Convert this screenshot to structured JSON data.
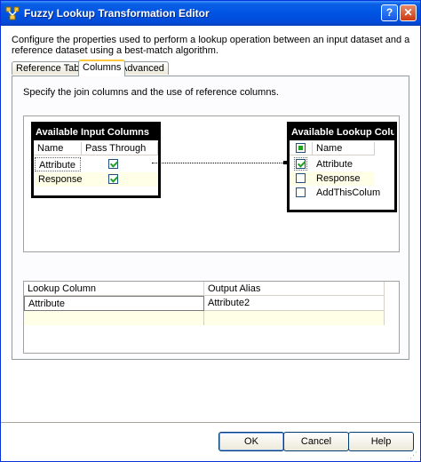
{
  "window": {
    "title": "Fuzzy Lookup Transformation Editor",
    "help_glyph": "?",
    "close_glyph": "✕"
  },
  "description": "Configure the properties used to perform a lookup operation between an input dataset and a reference dataset using a best-match algorithm.",
  "tabs": [
    {
      "label": "Reference Table",
      "active": false
    },
    {
      "label": "Columns",
      "active": true
    },
    {
      "label": "Advanced",
      "active": false
    }
  ],
  "instructions": "Specify the join columns and the use of reference columns.",
  "input_box": {
    "title": "Available Input Columns",
    "headers": {
      "name": "Name",
      "pass": "Pass Through"
    },
    "rows": [
      {
        "name": "Attribute",
        "pass_through": true
      },
      {
        "name": "Response",
        "pass_through": true
      }
    ]
  },
  "lookup_box": {
    "title": "Available Lookup Colu",
    "header_name": "Name",
    "rows": [
      {
        "name": "Attribute",
        "checked": true
      },
      {
        "name": "Response",
        "checked": false
      },
      {
        "name": "AddThisColum",
        "checked": false
      }
    ]
  },
  "grid": {
    "headers": {
      "lookup": "Lookup Column",
      "alias": "Output Alias"
    },
    "rows": [
      {
        "lookup": "Attribute",
        "alias": "Attribute2"
      }
    ]
  },
  "buttons": {
    "ok": "OK",
    "cancel": "Cancel",
    "help": "Help"
  },
  "colors": {
    "titlebar": "#0054e3",
    "highlight_row": "#fffee6",
    "check": "#21a121"
  }
}
